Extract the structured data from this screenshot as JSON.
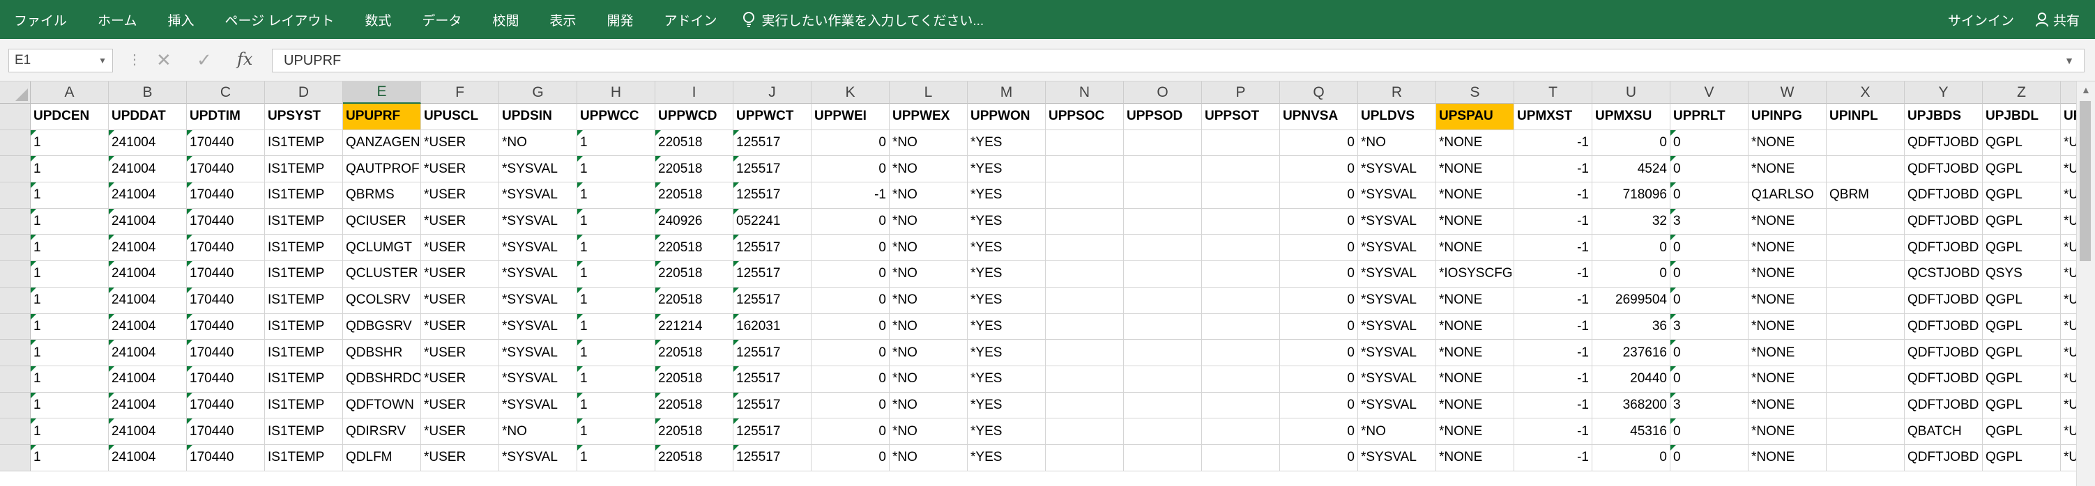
{
  "ribbon": {
    "tabs": [
      "ファイル",
      "ホーム",
      "挿入",
      "ページ レイアウト",
      "数式",
      "データ",
      "校閲",
      "表示",
      "開発",
      "アドイン"
    ],
    "tell_me": "実行したい作業を入力してください...",
    "sign_in": "サインイン",
    "share": "共有",
    "accent": "#217346"
  },
  "formula_bar": {
    "name_box": "E1",
    "formula": "UPUPRF",
    "fx": "fx",
    "cancel": "✕",
    "enter": "✓"
  },
  "sheet": {
    "selected_column": "E",
    "highlight_color": "#ffc000",
    "columns": [
      "A",
      "B",
      "C",
      "D",
      "E",
      "F",
      "G",
      "H",
      "I",
      "J",
      "K",
      "L",
      "M",
      "N",
      "O",
      "P",
      "Q",
      "R",
      "S",
      "T",
      "U",
      "V",
      "W",
      "X",
      "Y",
      "Z",
      "AA"
    ],
    "headers": [
      "UPDCEN",
      "UPDDAT",
      "UPDTIM",
      "UPSYST",
      "UPUPRF",
      "UPUSCL",
      "UPDSIN",
      "UPPWCC",
      "UPPWCD",
      "UPPWCT",
      "UPPWEI",
      "UPPWEX",
      "UPPWON",
      "UPPSOC",
      "UPPSOD",
      "UPPSOT",
      "UPNVSA",
      "UPLDVS",
      "UPSPAU",
      "UPMXST",
      "UPMXSU",
      "UPPRLT",
      "UPINPG",
      "UPINPL",
      "UPJBDS",
      "UPJBDL",
      "UPOW"
    ],
    "rows": [
      [
        "1",
        "241004",
        "170440",
        "IS1TEMP",
        "QANZAGEN",
        "*USER",
        "*NO",
        "1",
        "220518",
        "125517",
        "0",
        "*NO",
        "*YES",
        "",
        "",
        "",
        "0",
        "*NO",
        "*NONE",
        "-1",
        "0",
        "0",
        "*NONE",
        "",
        "QDFTJOBD",
        "QGPL",
        "*USRP"
      ],
      [
        "1",
        "241004",
        "170440",
        "IS1TEMP",
        "QAUTPROF",
        "*USER",
        "*SYSVAL",
        "1",
        "220518",
        "125517",
        "0",
        "*NO",
        "*YES",
        "",
        "",
        "",
        "0",
        "*SYSVAL",
        "*NONE",
        "-1",
        "4524",
        "0",
        "*NONE",
        "",
        "QDFTJOBD",
        "QGPL",
        "*USRP"
      ],
      [
        "1",
        "241004",
        "170440",
        "IS1TEMP",
        "QBRMS",
        "*USER",
        "*SYSVAL",
        "1",
        "220518",
        "125517",
        "-1",
        "*NO",
        "*YES",
        "",
        "",
        "",
        "0",
        "*SYSVAL",
        "*NONE",
        "-1",
        "718096",
        "0",
        "Q1ARLSO",
        "QBRM",
        "QDFTJOBD",
        "QGPL",
        "*USRP"
      ],
      [
        "1",
        "241004",
        "170440",
        "IS1TEMP",
        "QCIUSER",
        "*USER",
        "*SYSVAL",
        "1",
        "240926",
        "052241",
        "0",
        "*NO",
        "*YES",
        "",
        "",
        "",
        "0",
        "*SYSVAL",
        "*NONE",
        "-1",
        "32",
        "3",
        "*NONE",
        "",
        "QDFTJOBD",
        "QGPL",
        "*USRP"
      ],
      [
        "1",
        "241004",
        "170440",
        "IS1TEMP",
        "QCLUMGT",
        "*USER",
        "*SYSVAL",
        "1",
        "220518",
        "125517",
        "0",
        "*NO",
        "*YES",
        "",
        "",
        "",
        "0",
        "*SYSVAL",
        "*NONE",
        "-1",
        "0",
        "0",
        "*NONE",
        "",
        "QDFTJOBD",
        "QGPL",
        "*USRP"
      ],
      [
        "1",
        "241004",
        "170440",
        "IS1TEMP",
        "QCLUSTER",
        "*USER",
        "*SYSVAL",
        "1",
        "220518",
        "125517",
        "0",
        "*NO",
        "*YES",
        "",
        "",
        "",
        "0",
        "*SYSVAL",
        "*IOSYSCFG",
        "-1",
        "0",
        "0",
        "*NONE",
        "",
        "QCSTJOBD",
        "QSYS",
        "*USRP"
      ],
      [
        "1",
        "241004",
        "170440",
        "IS1TEMP",
        "QCOLSRV",
        "*USER",
        "*SYSVAL",
        "1",
        "220518",
        "125517",
        "0",
        "*NO",
        "*YES",
        "",
        "",
        "",
        "0",
        "*SYSVAL",
        "*NONE",
        "-1",
        "2699504",
        "0",
        "*NONE",
        "",
        "QDFTJOBD",
        "QGPL",
        "*USRP"
      ],
      [
        "1",
        "241004",
        "170440",
        "IS1TEMP",
        "QDBGSRV",
        "*USER",
        "*SYSVAL",
        "1",
        "221214",
        "162031",
        "0",
        "*NO",
        "*YES",
        "",
        "",
        "",
        "0",
        "*SYSVAL",
        "*NONE",
        "-1",
        "36",
        "3",
        "*NONE",
        "",
        "QDFTJOBD",
        "QGPL",
        "*USRP"
      ],
      [
        "1",
        "241004",
        "170440",
        "IS1TEMP",
        "QDBSHR",
        "*USER",
        "*SYSVAL",
        "1",
        "220518",
        "125517",
        "0",
        "*NO",
        "*YES",
        "",
        "",
        "",
        "0",
        "*SYSVAL",
        "*NONE",
        "-1",
        "237616",
        "0",
        "*NONE",
        "",
        "QDFTJOBD",
        "QGPL",
        "*USRP"
      ],
      [
        "1",
        "241004",
        "170440",
        "IS1TEMP",
        "QDBSHRDO",
        "*USER",
        "*SYSVAL",
        "1",
        "220518",
        "125517",
        "0",
        "*NO",
        "*YES",
        "",
        "",
        "",
        "0",
        "*SYSVAL",
        "*NONE",
        "-1",
        "20440",
        "0",
        "*NONE",
        "",
        "QDFTJOBD",
        "QGPL",
        "*USRP"
      ],
      [
        "1",
        "241004",
        "170440",
        "IS1TEMP",
        "QDFTOWN",
        "*USER",
        "*SYSVAL",
        "1",
        "220518",
        "125517",
        "0",
        "*NO",
        "*YES",
        "",
        "",
        "",
        "0",
        "*SYSVAL",
        "*NONE",
        "-1",
        "368200",
        "3",
        "*NONE",
        "",
        "QDFTJOBD",
        "QGPL",
        "*USRP"
      ],
      [
        "1",
        "241004",
        "170440",
        "IS1TEMP",
        "QDIRSRV",
        "*USER",
        "*NO",
        "1",
        "220518",
        "125517",
        "0",
        "*NO",
        "*YES",
        "",
        "",
        "",
        "0",
        "*NO",
        "*NONE",
        "-1",
        "45316",
        "0",
        "*NONE",
        "",
        "QBATCH",
        "QGPL",
        "*USRP"
      ],
      [
        "1",
        "241004",
        "170440",
        "IS1TEMP",
        "QDLFM",
        "*USER",
        "*SYSVAL",
        "1",
        "220518",
        "125517",
        "0",
        "*NO",
        "*YES",
        "",
        "",
        "",
        "0",
        "*SYSVAL",
        "*NONE",
        "-1",
        "0",
        "0",
        "*NONE",
        "",
        "QDFTJOBD",
        "QGPL",
        "*USRP"
      ]
    ]
  }
}
